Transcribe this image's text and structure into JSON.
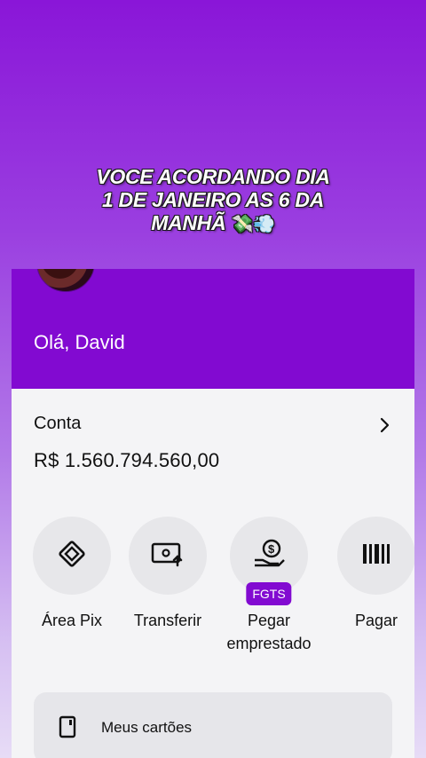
{
  "caption": {
    "line1": "VOCE ACORDANDO DIA",
    "line2": "1 DE JANEIRO AS 6 DA",
    "line3": "MANHÃ",
    "emoji": "💸💨"
  },
  "header": {
    "greeting": "Olá, David"
  },
  "account": {
    "label": "Conta",
    "balance": "R$ 1.560.794.560,00"
  },
  "actions": [
    {
      "label": "Área Pix",
      "icon": "pix-icon"
    },
    {
      "label": "Transferir",
      "icon": "transfer-icon"
    },
    {
      "label": "Pegar emprestado",
      "icon": "loan-icon",
      "badge": "FGTS"
    },
    {
      "label": "Pagar",
      "icon": "barcode-icon"
    }
  ],
  "cards": {
    "label": "Meus cartões"
  },
  "colors": {
    "brand": "#820ad1",
    "background": "#f4f4f6"
  }
}
